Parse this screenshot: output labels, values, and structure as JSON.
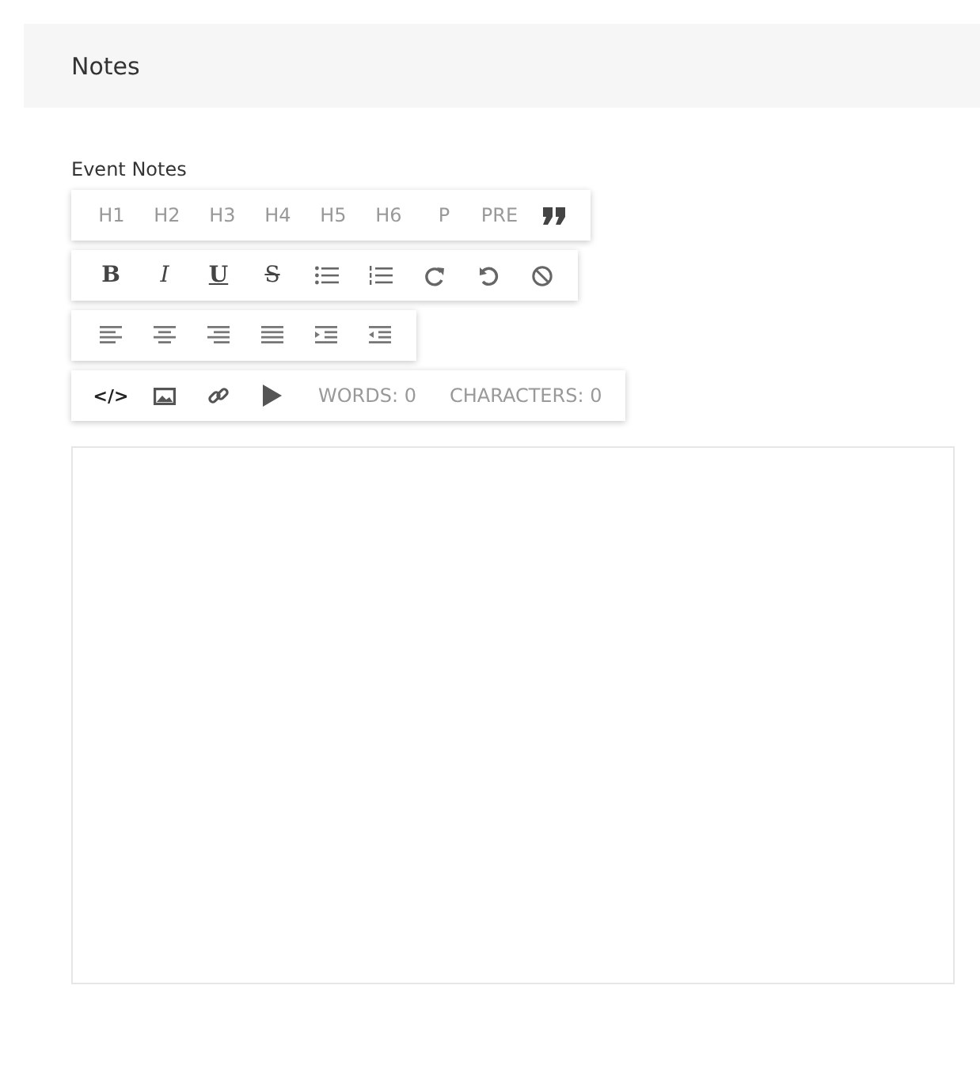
{
  "panel": {
    "title": "Notes"
  },
  "field": {
    "label": "Event Notes"
  },
  "toolbars": [
    {
      "items": [
        {
          "kind": "text",
          "label": "H1"
        },
        {
          "kind": "text",
          "label": "H2"
        },
        {
          "kind": "text",
          "label": "H3"
        },
        {
          "kind": "text",
          "label": "H4"
        },
        {
          "kind": "text",
          "label": "H5"
        },
        {
          "kind": "text",
          "label": "H6"
        },
        {
          "kind": "text",
          "label": "P"
        },
        {
          "kind": "text",
          "label": "PRE"
        },
        {
          "kind": "quote"
        }
      ]
    },
    {
      "items": [
        {
          "kind": "bold",
          "label": "B"
        },
        {
          "kind": "italic",
          "label": "I"
        },
        {
          "kind": "underline",
          "label": "U"
        },
        {
          "kind": "strike",
          "label": "S"
        },
        {
          "kind": "bullets"
        },
        {
          "kind": "numbers"
        },
        {
          "kind": "redo"
        },
        {
          "kind": "undo"
        },
        {
          "kind": "clear"
        }
      ]
    },
    {
      "items": [
        {
          "kind": "align-left"
        },
        {
          "kind": "align-center"
        },
        {
          "kind": "align-right"
        },
        {
          "kind": "justify"
        },
        {
          "kind": "indent"
        },
        {
          "kind": "outdent"
        }
      ]
    },
    {
      "items": [
        {
          "kind": "code",
          "label": "</>"
        },
        {
          "kind": "image"
        },
        {
          "kind": "link"
        },
        {
          "kind": "video"
        },
        {
          "kind": "counter",
          "label": "WORDS: 0"
        },
        {
          "kind": "counter",
          "label": "CHARACTERS: 0"
        }
      ]
    }
  ]
}
